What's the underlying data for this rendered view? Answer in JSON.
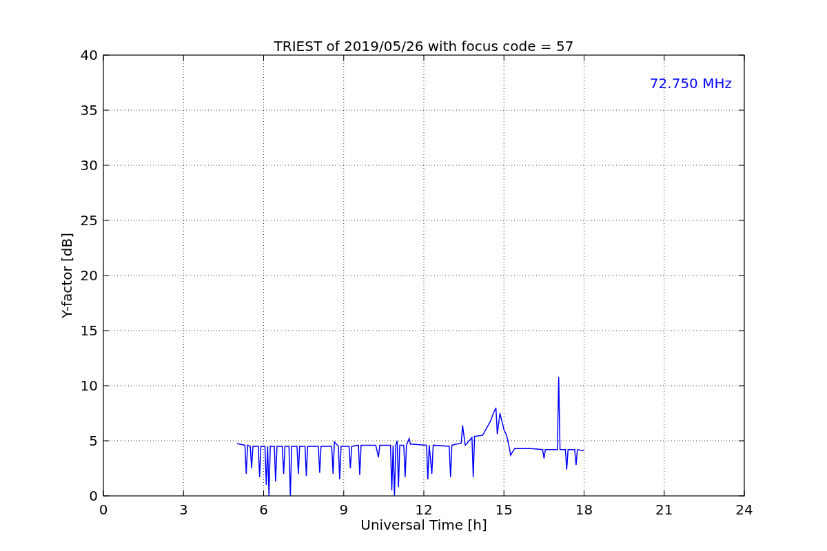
{
  "figure": {
    "chart_data": {
      "type": "line",
      "title": "TRIEST of 2019/05/26 with focus code = 57",
      "xlabel": "Universal Time [h]",
      "ylabel": "Y-factor [dB]",
      "x": [
        5.0,
        5.3,
        5.35,
        5.4,
        5.5,
        5.55,
        5.6,
        5.8,
        5.85,
        5.9,
        6.05,
        6.1,
        6.15,
        6.2,
        6.25,
        6.4,
        6.45,
        6.5,
        6.7,
        6.75,
        6.8,
        6.95,
        7.0,
        7.05,
        7.25,
        7.3,
        7.35,
        7.55,
        7.6,
        7.65,
        8.05,
        8.1,
        8.15,
        8.55,
        8.6,
        8.65,
        8.8,
        8.85,
        8.9,
        9.2,
        9.25,
        9.3,
        9.55,
        9.6,
        9.65,
        10.2,
        10.3,
        10.35,
        10.75,
        10.8,
        10.85,
        10.9,
        10.95,
        11.0,
        11.05,
        11.1,
        11.25,
        11.3,
        11.35,
        11.45,
        11.5,
        12.1,
        12.15,
        12.2,
        12.3,
        12.35,
        12.95,
        13.0,
        13.05,
        13.4,
        13.45,
        13.55,
        13.8,
        13.85,
        13.9,
        14.2,
        14.5,
        14.6,
        14.7,
        14.75,
        14.85,
        15.0,
        15.1,
        15.2,
        15.25,
        15.4,
        16.0,
        16.45,
        16.5,
        16.55,
        17.0,
        17.05,
        17.1,
        17.3,
        17.35,
        17.4,
        17.65,
        17.7,
        17.75,
        18.0
      ],
      "series": [
        {
          "name": "72.750 MHz",
          "color": "#0000ff",
          "values": [
            4.75,
            4.6,
            2.0,
            4.6,
            4.5,
            2.5,
            4.5,
            4.5,
            1.7,
            4.5,
            4.5,
            1.0,
            4.5,
            0.0,
            4.5,
            4.5,
            1.3,
            4.5,
            4.5,
            2.0,
            4.5,
            4.5,
            0.0,
            4.5,
            4.5,
            2.0,
            4.5,
            4.5,
            1.8,
            4.5,
            4.5,
            2.1,
            4.5,
            4.5,
            2.0,
            4.9,
            4.5,
            1.5,
            4.5,
            4.5,
            2.5,
            4.5,
            4.6,
            1.9,
            4.6,
            4.6,
            3.5,
            4.6,
            4.6,
            0.5,
            4.6,
            0.0,
            4.6,
            5.0,
            0.8,
            4.6,
            4.6,
            1.7,
            4.6,
            5.2,
            4.7,
            4.6,
            1.5,
            4.6,
            2.0,
            4.6,
            4.5,
            1.7,
            4.6,
            4.8,
            6.4,
            4.6,
            5.3,
            1.7,
            5.4,
            5.5,
            6.8,
            7.5,
            8.0,
            5.6,
            7.5,
            6.0,
            5.5,
            4.4,
            3.7,
            4.3,
            4.3,
            4.2,
            3.4,
            4.2,
            4.2,
            10.8,
            4.2,
            4.2,
            2.4,
            4.2,
            4.2,
            2.8,
            4.2,
            4.1
          ]
        }
      ],
      "xlim": [
        0,
        24
      ],
      "ylim": [
        0,
        40
      ],
      "grid": true,
      "xticks": [
        0,
        3,
        6,
        9,
        12,
        15,
        18,
        21,
        24
      ],
      "yticks": [
        0,
        5,
        10,
        15,
        20,
        25,
        30,
        35,
        40
      ]
    }
  }
}
